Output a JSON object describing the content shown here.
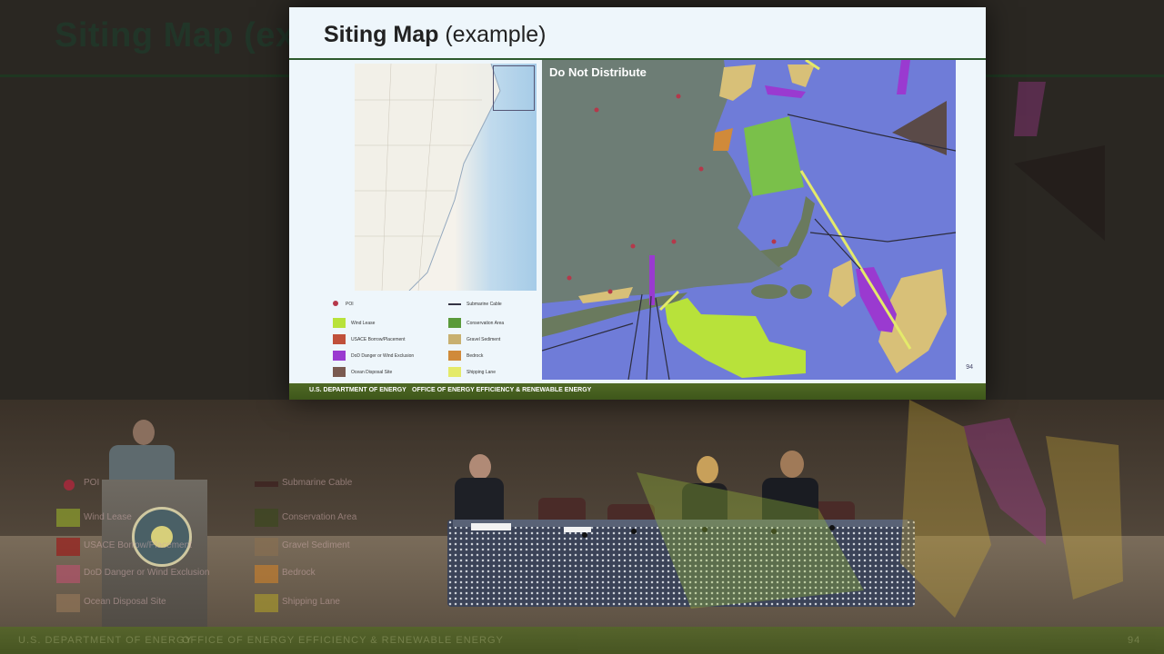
{
  "overlay": {
    "title": "Siting Map (example)",
    "footer_left": "U.S. DEPARTMENT OF ENERGY",
    "footer_right": "OFFICE OF ENERGY EFFICIENCY & RENEWABLE ENERGY",
    "page": "94"
  },
  "slide": {
    "title_bold": "Siting Map",
    "title_rest": "(example)",
    "map_label": "Do Not Distribute",
    "footer_left": "U.S. DEPARTMENT OF ENERGY",
    "footer_right": "OFFICE OF ENERGY EFFICIENCY & RENEWABLE ENERGY",
    "page": "94"
  },
  "legend": {
    "left": [
      {
        "label": "POI",
        "color": "#b5384a",
        "shape": "dot"
      },
      {
        "label": "Wind Lease",
        "color": "#b8e23a"
      },
      {
        "label": "USACE Borrow/Placement",
        "color": "#c0503a"
      },
      {
        "label": "DoD Danger or Wind Exclusion",
        "color": "#9a3ad0"
      },
      {
        "label": "Ocean Disposal Site",
        "color": "#7a5a50"
      }
    ],
    "right": [
      {
        "label": "Submarine Cable",
        "color": "#333344",
        "shape": "line"
      },
      {
        "label": "Conservation Area",
        "color": "#5a9a3a"
      },
      {
        "label": "Gravel Sediment",
        "color": "#c8b070"
      },
      {
        "label": "Bedrock",
        "color": "#d08a3a"
      },
      {
        "label": "Shipping Lane",
        "color": "#e4ea6a"
      }
    ]
  },
  "colors": {
    "ocean": "#6f7cd8",
    "wind_lease": "#b8e23a",
    "conservation": "#7ac04a",
    "dod": "#9a3ad0",
    "gravel": "#d8c078",
    "footer_green": "#4f6a25"
  }
}
